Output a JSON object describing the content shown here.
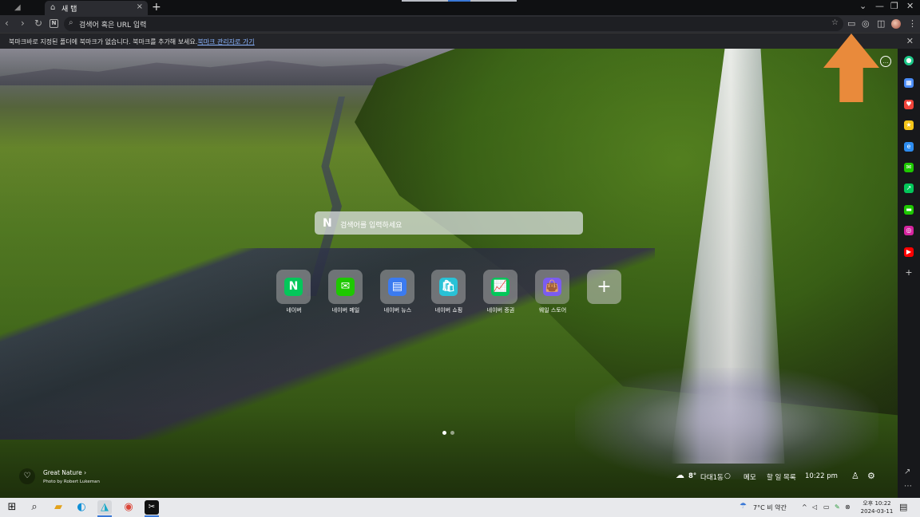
{
  "tab": {
    "title": "새 탭"
  },
  "address": {
    "placeholder": "검색어 혹은 URL 입력"
  },
  "bookmark_bar": {
    "message": "북마크바로 지정된 폴더에 북마크가 없습니다. 북마크를 추가해 보세요.",
    "link": "북마크 관리자로 가기"
  },
  "search": {
    "logo": "N",
    "placeholder": "검색어를 입력하세요"
  },
  "shortcuts": [
    {
      "label": "네이버",
      "glyph": "N",
      "color": "#03c75a"
    },
    {
      "label": "네이버 메일",
      "glyph": "✉",
      "color": "#1ec800"
    },
    {
      "label": "네이버 뉴스",
      "glyph": "▤",
      "color": "#3b7bf0"
    },
    {
      "label": "네이버 쇼핑",
      "glyph": "🛍",
      "color": "#29c2d6"
    },
    {
      "label": "네이버 증권",
      "glyph": "📈",
      "color": "#03c75a"
    },
    {
      "label": "웨일 스토어",
      "glyph": "👜",
      "color": "#7b5cf0"
    }
  ],
  "add_glyph": "+",
  "photo": {
    "title": "Great Nature",
    "chevron": "›",
    "credit": "Photo by Robert Lukeman"
  },
  "bottom": {
    "temperature": "8°",
    "location": "다대1동",
    "memo": "메모",
    "todo": "할 일 목록",
    "time": "10:22 pm"
  },
  "taskbar": {
    "weather": "7°C 비 약간",
    "time": "오후 10:22",
    "date": "2024-03-11"
  },
  "colors": {
    "arrow": "#e98a3b",
    "sidebar_bg": "#17181b",
    "accent": "#3a78d6"
  }
}
